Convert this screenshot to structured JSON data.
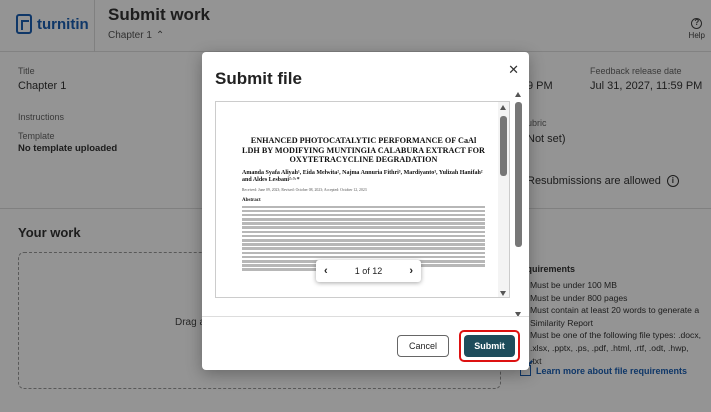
{
  "header": {
    "brand": "turnitin",
    "title": "Submit work",
    "subtitle": "Chapter 1",
    "help_label": "Help"
  },
  "details": {
    "title_label": "Title",
    "title_value": "Chapter 1",
    "instructions_label": "Instructions",
    "template_label": "Template",
    "template_value": "No template uploaded",
    "due_partial": "9 PM",
    "feedback_label": "Feedback release date",
    "feedback_value": "Jul 31, 2027, 11:59 PM",
    "rubric_label": "ubric",
    "rubric_value": "Not set)",
    "resubmissions": "Resubmissions are allowed"
  },
  "your_work": {
    "heading": "Your work",
    "drop_text": "Drag and"
  },
  "requirements": {
    "title": "requirements",
    "items": [
      "Must be under 100 MB",
      "Must be under 800 pages",
      "Must contain at least 20 words to generate a Similarity Report",
      "Must be one of the following file types: .docx, .xlsx, .pptx, .ps, .pdf, .html, .rtf, .odt, .hwp, .txt"
    ],
    "learn_more": "Learn more about file requirements"
  },
  "modal": {
    "title": "Submit file",
    "close_glyph": "✕",
    "cancel_label": "Cancel",
    "submit_label": "Submit",
    "highlight_color": "#dd1111",
    "submit_color": "#1e4d5c",
    "pager": {
      "prev_glyph": "‹",
      "next_glyph": "›",
      "text": "1 of 12"
    },
    "document": {
      "title": "ENHANCED PHOTOCATALYTIC PERFORMANCE OF CaAl LDH BY MODIFYING MUNTINGIA CALABURA EXTRACT FOR OXYTETRACYCLINE DEGRADATION",
      "authors": "Amanda Syafa Aliyah¹, Eida Melwita², Najma Annuria Fithri³, Mardiyanto³, Yulizah Hanifah² and Aldes Lesbani²·³·*",
      "dates": "Received: June 09, 2023; Revised: October 08, 2023; Accepted: October 12, 2023",
      "abstract_heading": "Abstract"
    }
  }
}
